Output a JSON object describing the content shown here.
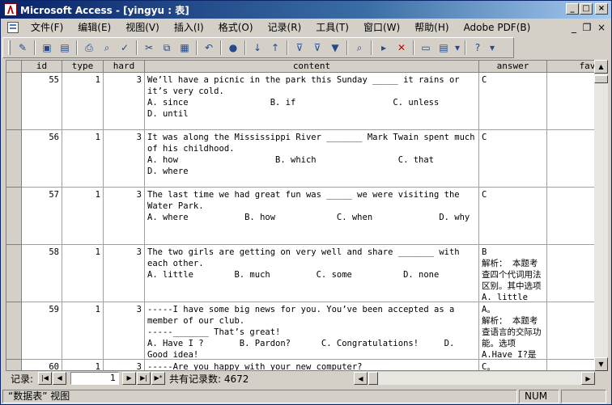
{
  "window": {
    "title": "Microsoft Access - [yingyu : 表]"
  },
  "menu": {
    "items": [
      "文件(F)",
      "编辑(E)",
      "视图(V)",
      "插入(I)",
      "格式(O)",
      "记录(R)",
      "工具(T)",
      "窗口(W)",
      "帮助(H)",
      "Adobe PDF(B)"
    ]
  },
  "grid": {
    "columns": [
      "id",
      "type",
      "hard",
      "content",
      "answer",
      "fav"
    ],
    "rows": [
      {
        "id": "55",
        "type": "1",
        "hard": "3",
        "content": "We’ll have a picnic in the park this Sunday _____ it rains or it’s very cold.\nA. since                B. if                   C. unless                D. until",
        "answer": "C"
      },
      {
        "id": "56",
        "type": "1",
        "hard": "3",
        "content": "It was along the Mississippi River _______ Mark Twain spent much of his childhood.\nA. how                   B. which                C. that                  D. where",
        "answer": "C"
      },
      {
        "id": "57",
        "type": "1",
        "hard": "3",
        "content": "The last time we had great fun was _____ we were visiting the Water Park.\nA. where           B. how            C. when             D. why",
        "answer": "C"
      },
      {
        "id": "58",
        "type": "1",
        "hard": "3",
        "content": "The two girls are getting on very well and share _______ with each other.\nA. little        B. much         C. some          D. none",
        "answer": "B\n解析： 本题考查四个代词用法区别。其中选项A. little"
      },
      {
        "id": "59",
        "type": "1",
        "hard": "3",
        "content": "-----I have some big news for you. You’ve been accepted as a member of our club.\n-----_______ That’s great!\nA. Have I ?       B. Pardon?      C. Congratulations!     D. Good idea!",
        "answer": "A。\n解析： 本题考查语言的交际功能。选项A.Have I?是"
      },
      {
        "id": "60",
        "type": "1",
        "hard": "3",
        "content": "-----Are you happy with your new computer?",
        "answer": "C。"
      }
    ]
  },
  "nav": {
    "label": "记录:",
    "current": "1",
    "total_text": "共有记录数: 4672"
  },
  "status": {
    "view": "“数据表” 视图",
    "num": "NUM"
  }
}
